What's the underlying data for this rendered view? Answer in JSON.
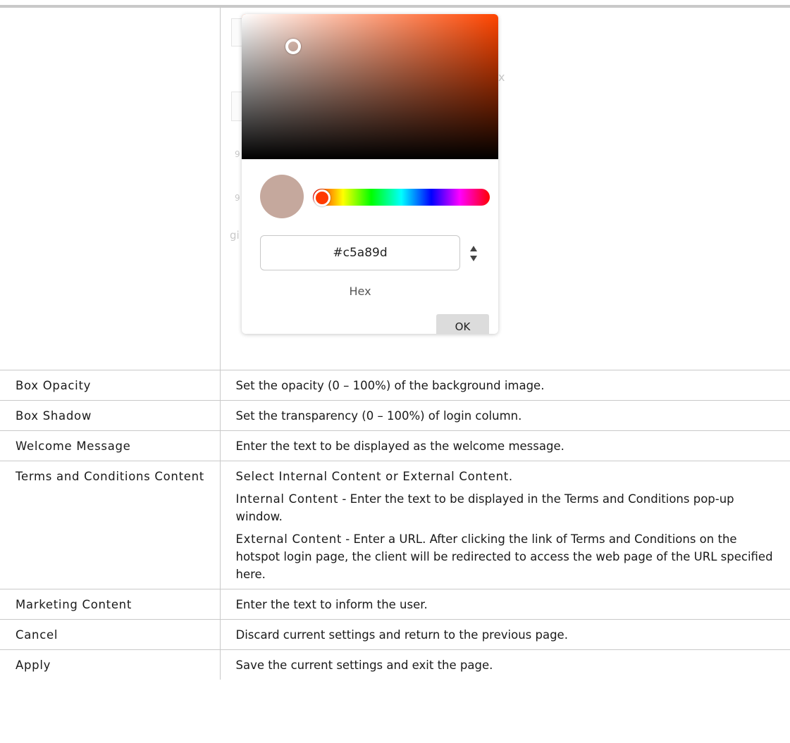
{
  "picker": {
    "hex_value": "#c5a89d",
    "hex_caption": "Hex",
    "ok_label": "OK",
    "swatch_color": "#c5a89d",
    "hue_color": "#ff4500",
    "ghost_chars": [
      "x",
      "9",
      "9",
      "gi"
    ]
  },
  "rows": [
    {
      "label": "Box Opacity",
      "paras": [
        {
          "term": "",
          "text": "Set the opacity (0 – 100%) of the background image."
        }
      ]
    },
    {
      "label": "Box Shadow",
      "paras": [
        {
          "term": "",
          "text": "Set the transparency (0 – 100%) of login column."
        }
      ]
    },
    {
      "label": "Welcome Message",
      "paras": [
        {
          "term": "",
          "text": "Enter the text to be displayed as the welcome message."
        }
      ]
    },
    {
      "label": "Terms and Conditions Content",
      "paras": [
        {
          "term": "Select Internal Content or External Content.",
          "text": ""
        },
        {
          "term": "Internal Content",
          "text": " - Enter the text to be displayed in the Terms and Conditions pop-up window."
        },
        {
          "term": "External Content",
          "text": " - Enter a URL. After clicking the link of Terms and Conditions on the hotspot login page, the client will be redirected to access the web page of the URL specified here."
        }
      ]
    },
    {
      "label": "Marketing Content",
      "paras": [
        {
          "term": "",
          "text": "Enter the text to inform the user."
        }
      ]
    },
    {
      "label": "Cancel",
      "paras": [
        {
          "term": "",
          "text": "Discard current settings and return to the previous page."
        }
      ]
    },
    {
      "label": "Apply",
      "paras": [
        {
          "term": "",
          "text": "Save the current settings and exit the page."
        }
      ]
    }
  ]
}
